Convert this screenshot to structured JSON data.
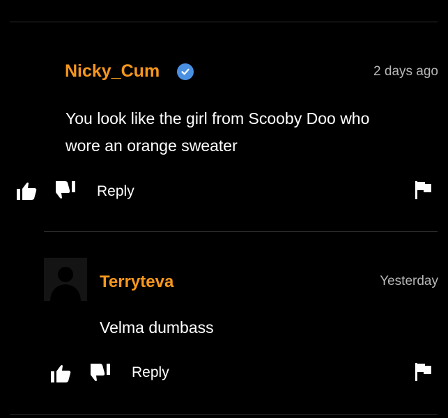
{
  "comments": [
    {
      "username": "Nicky_Cum",
      "verified": true,
      "timestamp": "2 days ago",
      "body_line1": "You look like the girl from Scooby Doo who",
      "body_line2": "wore an orange sweater",
      "reply_label": "Reply"
    },
    {
      "username": "Terryteva",
      "verified": false,
      "timestamp": "Yesterday",
      "body_line1": "Velma dumbass",
      "reply_label": "Reply"
    }
  ],
  "colors": {
    "background": "#000000",
    "username": "#f7971d",
    "text": "#ffffff",
    "timestamp": "#b8b8b8",
    "verified_badge": "#4a90e2",
    "divider": "#2e2e2e"
  },
  "icons": [
    "verified-badge-icon",
    "thumbs-up-icon",
    "thumbs-down-icon",
    "flag-icon",
    "default-avatar-icon"
  ]
}
